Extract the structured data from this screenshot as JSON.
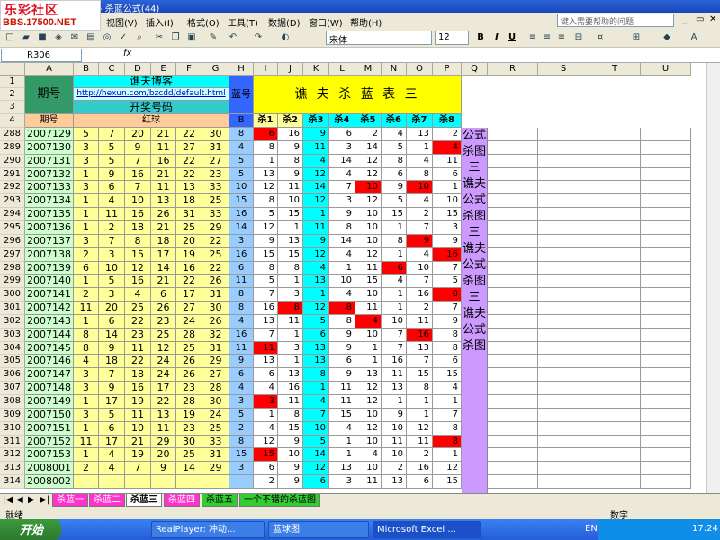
{
  "app": {
    "title": "- 杀蓝公式(44)",
    "logo_cn": "乐彩社区",
    "logo_url": "BBS.17500.NET"
  },
  "menu": [
    "视图(V)",
    "插入(I)",
    "格式(O)",
    "工具(T)",
    "数据(D)",
    "窗口(W)",
    "帮助(H)"
  ],
  "help_placeholder": "键入需要帮助的问题",
  "font": {
    "name": "宋体",
    "size": "12"
  },
  "format_buttons": [
    "B",
    "I",
    "U"
  ],
  "namebox": "R306",
  "fx_label": "fx",
  "columns": [
    "A",
    "B",
    "C",
    "D",
    "E",
    "F",
    "G",
    "H",
    "I",
    "J",
    "K",
    "L",
    "M",
    "N",
    "O",
    "P",
    "Q",
    "R",
    "S",
    "T",
    "U"
  ],
  "header": {
    "period": "期号",
    "blog_title": "谯夫博客",
    "url": "http://hexun.com/bzcdd/default.html",
    "draw_number": "开奖号码",
    "blue_label": "蓝号",
    "table_title": "谯 夫 杀 蓝 表 三",
    "row4_period": "期号",
    "red_ball": "红球",
    "B": "B",
    "kills": [
      "杀1",
      "杀2",
      "杀3",
      "杀4",
      "杀5",
      "杀6",
      "杀7",
      "杀8"
    ],
    "row_labels": [
      "1",
      "2",
      "3",
      "4"
    ]
  },
  "rows": [
    {
      "r": "288",
      "p": "2007129",
      "red": [
        "5",
        "7",
        "20",
        "21",
        "22",
        "30"
      ],
      "b": "8",
      "k": [
        "6",
        "16",
        "9",
        "6",
        "2",
        "4",
        "13",
        "2"
      ],
      "hl": [
        0
      ]
    },
    {
      "r": "289",
      "p": "2007130",
      "red": [
        "3",
        "5",
        "9",
        "11",
        "27",
        "31"
      ],
      "b": "4",
      "k": [
        "8",
        "9",
        "11",
        "3",
        "14",
        "5",
        "1",
        "4"
      ],
      "hl": [
        7
      ]
    },
    {
      "r": "290",
      "p": "2007131",
      "red": [
        "3",
        "5",
        "7",
        "16",
        "22",
        "27"
      ],
      "b": "5",
      "k": [
        "1",
        "8",
        "4",
        "14",
        "12",
        "8",
        "4",
        "11"
      ],
      "hl": []
    },
    {
      "r": "291",
      "p": "2007132",
      "red": [
        "1",
        "9",
        "16",
        "21",
        "22",
        "23"
      ],
      "b": "5",
      "k": [
        "13",
        "9",
        "12",
        "4",
        "12",
        "6",
        "8",
        "6"
      ],
      "hl": []
    },
    {
      "r": "292",
      "p": "2007133",
      "red": [
        "3",
        "6",
        "7",
        "11",
        "13",
        "33"
      ],
      "b": "10",
      "k": [
        "12",
        "11",
        "14",
        "7",
        "10",
        "9",
        "10",
        "1"
      ],
      "hl": [
        4,
        6
      ]
    },
    {
      "r": "293",
      "p": "2007134",
      "red": [
        "1",
        "4",
        "10",
        "13",
        "18",
        "25"
      ],
      "b": "15",
      "k": [
        "8",
        "10",
        "12",
        "3",
        "12",
        "5",
        "4",
        "10"
      ],
      "hl": []
    },
    {
      "r": "294",
      "p": "2007135",
      "red": [
        "1",
        "11",
        "16",
        "26",
        "31",
        "33"
      ],
      "b": "16",
      "k": [
        "5",
        "15",
        "1",
        "9",
        "10",
        "15",
        "2",
        "15"
      ],
      "hl": []
    },
    {
      "r": "295",
      "p": "2007136",
      "red": [
        "1",
        "2",
        "18",
        "21",
        "25",
        "29"
      ],
      "b": "14",
      "k": [
        "12",
        "1",
        "11",
        "8",
        "10",
        "1",
        "7",
        "3"
      ],
      "hl": []
    },
    {
      "r": "296",
      "p": "2007137",
      "red": [
        "3",
        "7",
        "8",
        "18",
        "20",
        "22"
      ],
      "b": "3",
      "k": [
        "9",
        "13",
        "9",
        "14",
        "10",
        "8",
        "9",
        "9"
      ],
      "hl": [
        6
      ]
    },
    {
      "r": "297",
      "p": "2007138",
      "red": [
        "2",
        "3",
        "15",
        "17",
        "19",
        "25"
      ],
      "b": "16",
      "k": [
        "15",
        "15",
        "12",
        "4",
        "12",
        "1",
        "4",
        "16"
      ],
      "hl": [
        7
      ]
    },
    {
      "r": "298",
      "p": "2007139",
      "red": [
        "6",
        "10",
        "12",
        "14",
        "16",
        "22"
      ],
      "b": "6",
      "k": [
        "8",
        "8",
        "4",
        "1",
        "11",
        "6",
        "10",
        "7"
      ],
      "hl": [
        5
      ]
    },
    {
      "r": "299",
      "p": "2007140",
      "red": [
        "1",
        "5",
        "16",
        "21",
        "22",
        "26"
      ],
      "b": "11",
      "k": [
        "5",
        "1",
        "13",
        "10",
        "15",
        "4",
        "7",
        "5"
      ],
      "hl": []
    },
    {
      "r": "300",
      "p": "2007141",
      "red": [
        "2",
        "3",
        "4",
        "6",
        "17",
        "31"
      ],
      "b": "8",
      "k": [
        "7",
        "3",
        "1",
        "4",
        "10",
        "1",
        "16",
        "8"
      ],
      "hl": [
        7
      ]
    },
    {
      "r": "301",
      "p": "2007142",
      "red": [
        "11",
        "20",
        "25",
        "26",
        "27",
        "30"
      ],
      "b": "8",
      "k": [
        "16",
        "8",
        "12",
        "8",
        "11",
        "1",
        "2",
        "7"
      ],
      "hl": [
        1,
        3
      ]
    },
    {
      "r": "302",
      "p": "2007143",
      "red": [
        "1",
        "6",
        "22",
        "23",
        "24",
        "26"
      ],
      "b": "4",
      "k": [
        "13",
        "11",
        "5",
        "8",
        "4",
        "10",
        "11",
        "9"
      ],
      "hl": [
        4
      ]
    },
    {
      "r": "303",
      "p": "2007144",
      "red": [
        "8",
        "14",
        "23",
        "25",
        "28",
        "32"
      ],
      "b": "16",
      "k": [
        "7",
        "1",
        "6",
        "9",
        "10",
        "7",
        "16",
        "8"
      ],
      "hl": [
        6
      ]
    },
    {
      "r": "304",
      "p": "2007145",
      "red": [
        "8",
        "9",
        "11",
        "12",
        "25",
        "31"
      ],
      "b": "11",
      "k": [
        "11",
        "3",
        "13",
        "9",
        "1",
        "7",
        "13",
        "8"
      ],
      "hl": [
        0
      ]
    },
    {
      "r": "305",
      "p": "2007146",
      "red": [
        "4",
        "18",
        "22",
        "24",
        "26",
        "29"
      ],
      "b": "9",
      "k": [
        "13",
        "1",
        "13",
        "6",
        "1",
        "16",
        "7",
        "6"
      ],
      "hl": []
    },
    {
      "r": "306",
      "p": "2007147",
      "red": [
        "3",
        "7",
        "18",
        "24",
        "26",
        "27"
      ],
      "b": "6",
      "k": [
        "6",
        "13",
        "8",
        "9",
        "13",
        "11",
        "15",
        "15"
      ],
      "hl": []
    },
    {
      "r": "307",
      "p": "2007148",
      "red": [
        "3",
        "9",
        "16",
        "17",
        "23",
        "28"
      ],
      "b": "4",
      "k": [
        "4",
        "16",
        "1",
        "11",
        "12",
        "13",
        "8",
        "4"
      ],
      "hl": []
    },
    {
      "r": "308",
      "p": "2007149",
      "red": [
        "1",
        "17",
        "19",
        "22",
        "28",
        "30"
      ],
      "b": "3",
      "k": [
        "3",
        "11",
        "4",
        "11",
        "12",
        "1",
        "1",
        "1"
      ],
      "hl": [
        0
      ]
    },
    {
      "r": "309",
      "p": "2007150",
      "red": [
        "3",
        "5",
        "11",
        "13",
        "19",
        "24"
      ],
      "b": "5",
      "k": [
        "1",
        "8",
        "7",
        "15",
        "10",
        "9",
        "1",
        "7"
      ],
      "hl": []
    },
    {
      "r": "310",
      "p": "2007151",
      "red": [
        "1",
        "6",
        "10",
        "11",
        "23",
        "25"
      ],
      "b": "2",
      "k": [
        "4",
        "15",
        "10",
        "4",
        "12",
        "10",
        "12",
        "8"
      ],
      "hl": []
    },
    {
      "r": "311",
      "p": "2007152",
      "red": [
        "11",
        "17",
        "21",
        "29",
        "30",
        "33"
      ],
      "b": "8",
      "k": [
        "12",
        "9",
        "5",
        "1",
        "10",
        "11",
        "11",
        "8"
      ],
      "hl": [
        7
      ]
    },
    {
      "r": "312",
      "p": "2007153",
      "red": [
        "1",
        "4",
        "19",
        "20",
        "25",
        "31"
      ],
      "b": "15",
      "k": [
        "15",
        "10",
        "14",
        "1",
        "4",
        "10",
        "2",
        "1"
      ],
      "hl": [
        0
      ]
    },
    {
      "r": "313",
      "p": "2008001",
      "red": [
        "2",
        "4",
        "7",
        "9",
        "14",
        "29"
      ],
      "b": "3",
      "k": [
        "6",
        "9",
        "12",
        "13",
        "10",
        "2",
        "16",
        "12"
      ],
      "hl": []
    },
    {
      "r": "314",
      "p": "2008002",
      "red": [
        "",
        "",
        "",
        "",
        "",
        ""
      ],
      "b": "",
      "k": [
        "2",
        "9",
        "6",
        "3",
        "11",
        "13",
        "6",
        "15"
      ],
      "hl": []
    }
  ],
  "vertical_text": "公式杀图三 谯夫公式杀图三 谯夫公式杀图三 谯夫公式杀图",
  "sheets": [
    "杀蓝一",
    "杀蓝二",
    "杀蓝三",
    "杀蓝四",
    "杀蓝五",
    "一个不错的杀蓝图"
  ],
  "status": {
    "ready": "就绪",
    "mode": "数字"
  },
  "taskbar": {
    "start": "开始",
    "tasks": [
      "RealPlayer: 冲动...",
      "蓝球图",
      "Microsoft Excel ..."
    ],
    "lang": "EN",
    "clock": "17:24"
  },
  "colors": {
    "red_hl": "#ff0000",
    "yellow": "#ffff99",
    "cyan": "#00ffff",
    "teal": "#33cccc",
    "green": "#339966",
    "purple": "#cc99ff",
    "blue": "#3366ff",
    "orange": "#ffcc99",
    "light_green": "#ccffcc"
  }
}
